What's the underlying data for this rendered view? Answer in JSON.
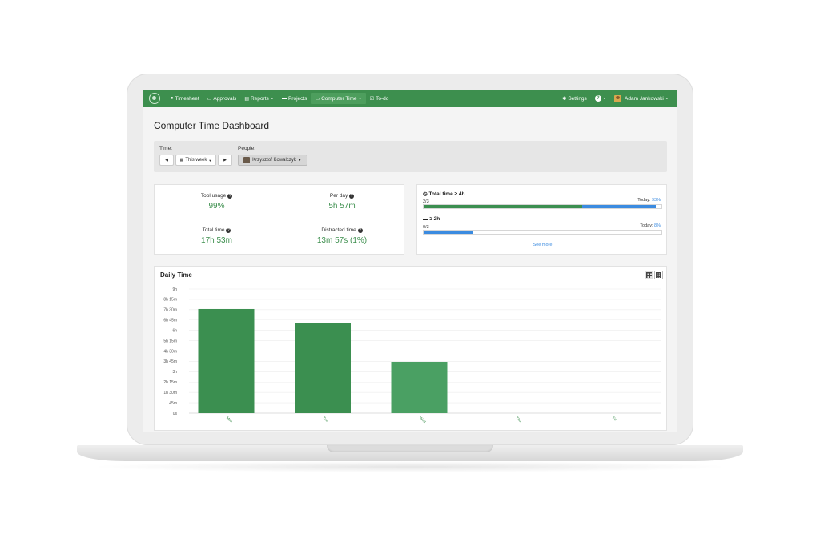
{
  "navbar": {
    "items": [
      {
        "label": "Timesheet",
        "icon": "clock-icon"
      },
      {
        "label": "Approvals",
        "icon": "inbox-icon"
      },
      {
        "label": "Reports",
        "icon": "document-icon",
        "caret": true
      },
      {
        "label": "Projects",
        "icon": "folder-icon"
      },
      {
        "label": "Computer Time",
        "icon": "laptop-icon",
        "caret": true,
        "active": true
      },
      {
        "label": "To-do",
        "icon": "checkbox-icon"
      }
    ],
    "settings_label": "Settings",
    "help_label": "?",
    "user_name": "Adam Jankowski"
  },
  "page": {
    "title": "Computer Time Dashboard"
  },
  "filters": {
    "time_label": "Time:",
    "prev_label": "◀",
    "period_label": "This week",
    "next_label": "▶",
    "people_label": "People:",
    "person_name": "Krzysztof Kowalczyk"
  },
  "stats": {
    "tool_usage_label": "Tool usage",
    "tool_usage_value": "99%",
    "per_day_label": "Per day",
    "per_day_value": "5h 57m",
    "total_time_label": "Total time",
    "total_time_value": "17h 53m",
    "distracted_label": "Distracted time",
    "distracted_value": "13m 57s (1%)"
  },
  "goals": {
    "items": [
      {
        "title": "Total time ≥ 4h",
        "icon": "clock-icon",
        "count": "2/3",
        "today_label": "Today:",
        "today_pct": "93%",
        "green_fraction": 0.6667,
        "blue_fraction": 0.31
      },
      {
        "title": "≥ 2h",
        "icon": "folder-icon",
        "count": "0/3",
        "today_label": "Today:",
        "today_pct": "8%",
        "green_fraction": 0,
        "blue_fraction": 0.21
      }
    ],
    "see_more_label": "See more"
  },
  "daily": {
    "title": "Daily Time"
  },
  "colors": {
    "brand_green": "#3d8f4e",
    "bar_green": "#3b8f50",
    "bar_green_light": "#4aa063",
    "progress_blue": "#3b8be0"
  },
  "chart_data": {
    "type": "bar",
    "title": "Daily Time",
    "categories": [
      "Mon",
      "Tue",
      "Wed",
      "Thu",
      "Fri"
    ],
    "values_minutes": [
      453,
      391,
      223,
      0,
      0
    ],
    "y_ticks": [
      "0s",
      "45m",
      "1h 30m",
      "2h 15m",
      "3h",
      "3h 45m",
      "4h 30m",
      "5h 15m",
      "6h",
      "6h 45m",
      "7h 30m",
      "8h 15m",
      "9h"
    ],
    "ylim_minutes": [
      0,
      540
    ],
    "grid": true
  }
}
